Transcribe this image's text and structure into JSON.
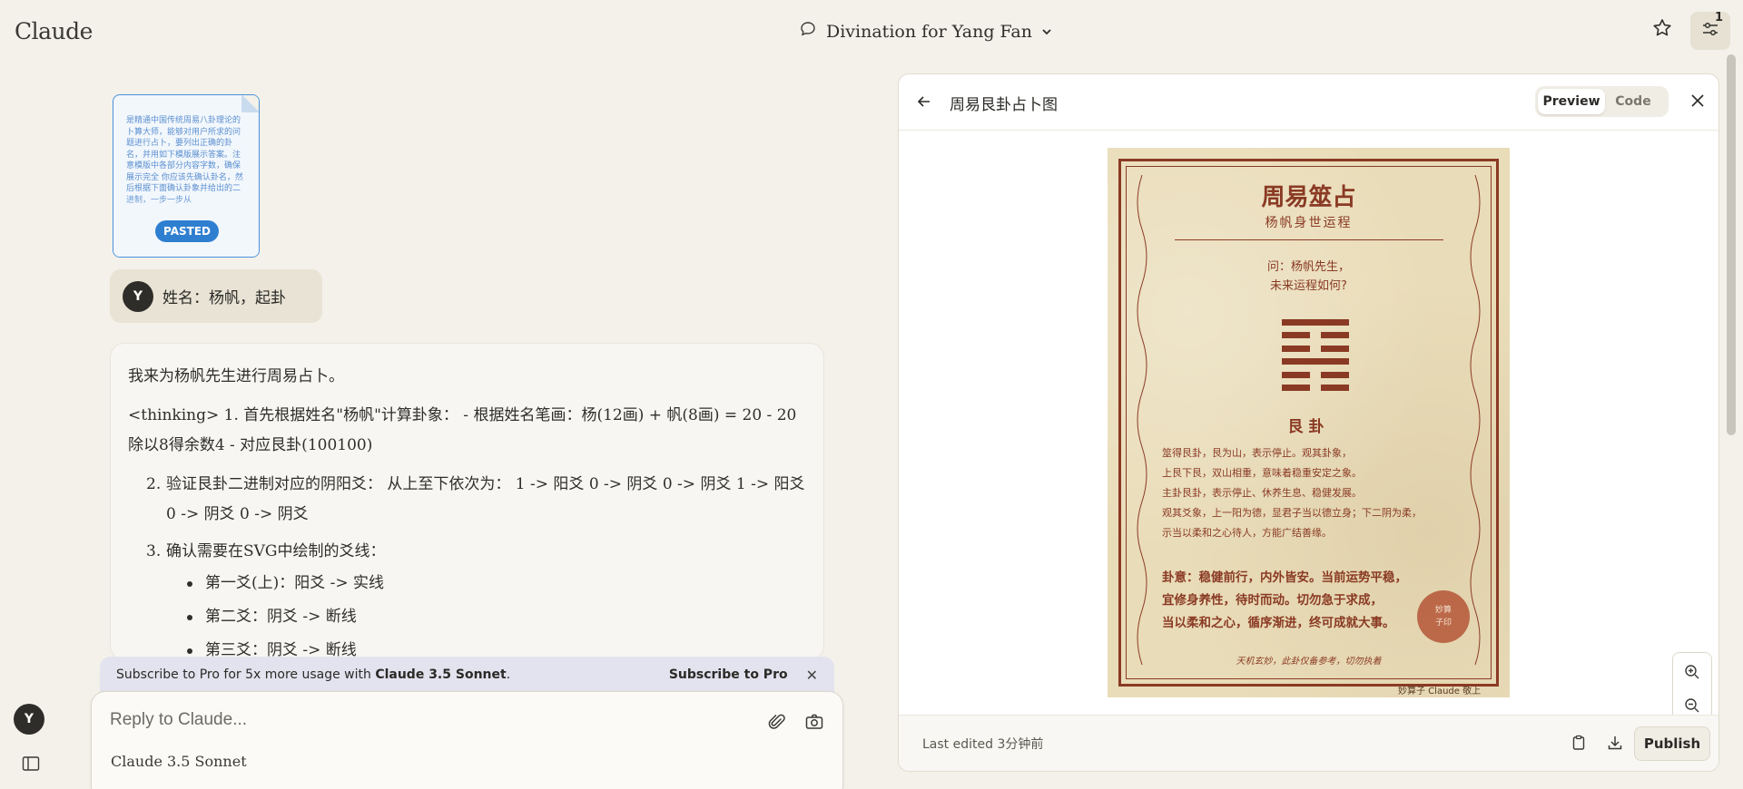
{
  "app": {
    "brand": "Claude"
  },
  "conversation": {
    "title": "Divination for Yang Fan"
  },
  "header": {
    "notification_count": "1"
  },
  "pasted": {
    "badge": "PASTED",
    "preview_text": "是精通中国传统周易八卦理论的卜算大师，能够对用户所求的问题进行占卜，要列出正确的卦名，并用如下模版展示答案。注意模版中各部分内容字数，确保展示完全 你应该先确认卦名，然后根据下面确认卦象并给出的二进制，一步一步从"
  },
  "user": {
    "initial": "Y",
    "message": "姓名：杨帆，起卦"
  },
  "assistant": {
    "intro": "我来为杨帆先生进行周易占卜。",
    "thinking": "<thinking> 1. 首先根据姓名\"杨帆\"计算卦象： - 根据姓名笔画：杨(12画) + 帆(8画) = 20 - 20除以8得余数4 - 对应艮卦(100100)",
    "steps": [
      {
        "num": "2.",
        "text": "验证艮卦二进制对应的阴阳爻： 从上至下依次为： 1 -> 阳爻 0 -> 阴爻 0 -> 阴爻 1 -> 阳爻 0 -> 阴爻 0 -> 阴爻"
      },
      {
        "num": "3.",
        "text": "确认需要在SVG中绘制的爻线："
      }
    ],
    "bullets": [
      "第一爻(上)：阳爻 -> 实线",
      "第二爻：阴爻 -> 断线",
      "第三爻：阴爻 -> 断线"
    ]
  },
  "pro_banner": {
    "text_prefix": "Subscribe to Pro for 5x more usage with ",
    "text_model": "Claude 3.5 Sonnet",
    "text_suffix": ".",
    "link": "Subscribe to Pro"
  },
  "composer": {
    "placeholder": "Reply to Claude...",
    "model": "Claude 3.5 Sonnet"
  },
  "artifact": {
    "title": "周易艮卦占卜图",
    "tabs": [
      "Preview",
      "Code"
    ],
    "last_edited": "Last edited 3分钟前",
    "publish": "Publish",
    "card": {
      "title": "周易筮占",
      "subtitle": "杨帆身世运程",
      "question_1": "问：杨帆先生，",
      "question_2": "未来运程如何?",
      "hexagram_lines": [
        1,
        0,
        0,
        1,
        0,
        0
      ],
      "hexagram_name": "艮卦",
      "body": [
        "筮得艮卦，艮为山，表示停止。观其卦象，",
        "上艮下艮，双山相重，意味着稳重安定之象。",
        "主卦艮卦，表示停止、休养生息、稳健发展。",
        "观其爻象，上一阳为德，显君子当以德立身；下二阴为柔，",
        "示当以柔和之心待人，方能广结善缘。"
      ],
      "verdict": [
        "卦意：稳健前行，内外皆安。当前运势平稳，",
        "宜修身养性，待时而动。切勿急于求成，",
        "当以柔和之心，循序渐进，终可成就大事。"
      ],
      "seal": [
        "妙算",
        "子印"
      ],
      "footer": "天机玄妙，此卦仅备参考，切勿执着",
      "signature": "妙算子 Claude 敬上"
    }
  },
  "colors": {
    "background": "#f3f1ea",
    "card_ink": "#8a3a24",
    "card_paper": "#e9dcb8",
    "pasted_accent": "#2f7fd1"
  }
}
